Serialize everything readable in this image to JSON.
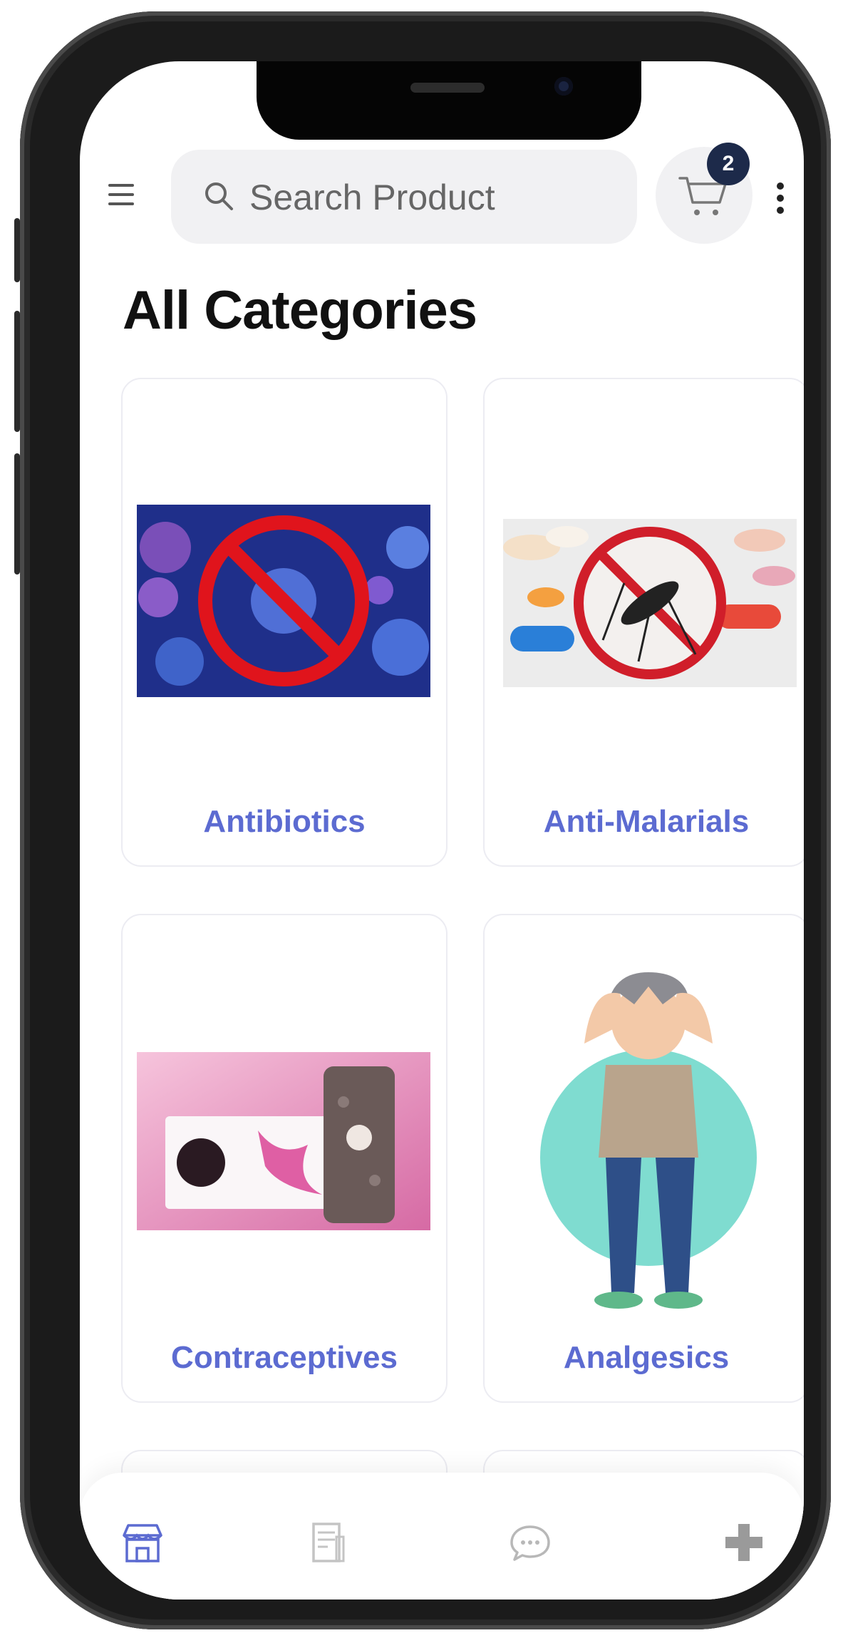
{
  "header": {
    "search_placeholder": "Search Product",
    "cart_count": "2"
  },
  "page_title": "All Categories",
  "categories": [
    {
      "label": "Antibiotics"
    },
    {
      "label": "Anti-Malarials"
    },
    {
      "label": "Contraceptives"
    },
    {
      "label": "Analgesics"
    }
  ],
  "bottom_nav": {
    "items": [
      {
        "icon": "store-icon",
        "active": true
      },
      {
        "icon": "orders-icon",
        "active": false
      },
      {
        "icon": "chat-icon",
        "active": false
      },
      {
        "icon": "pharmacy-cross-icon",
        "active": false
      }
    ]
  },
  "colors": {
    "accent": "#5c6bd1",
    "badge": "#1d2a4a",
    "search_bg": "#f1f1f3"
  }
}
